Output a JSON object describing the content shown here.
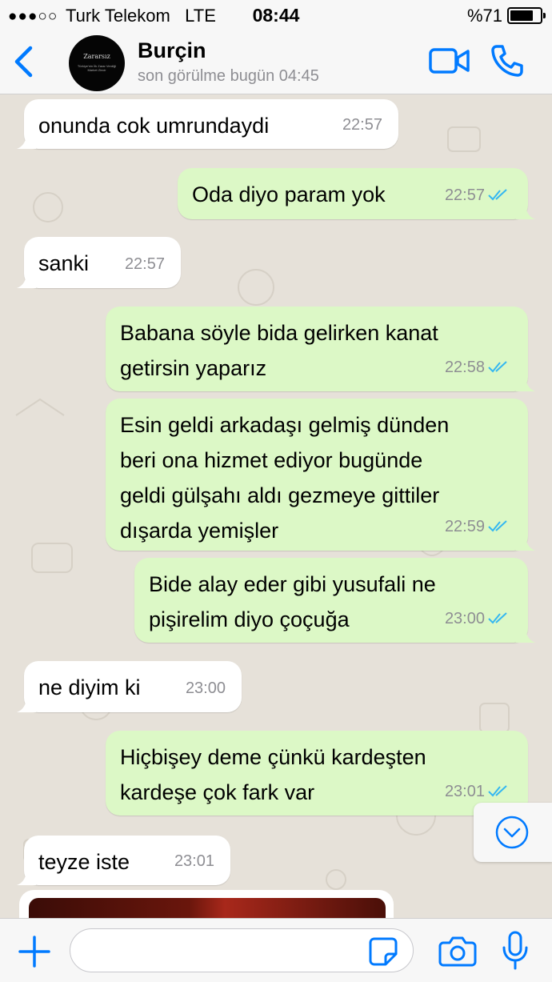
{
  "status_bar": {
    "signal": "●●●○○",
    "carrier": "Turk Telekom",
    "network": "LTE",
    "time": "08:44",
    "battery": "%71"
  },
  "header": {
    "avatar_text": "Zararsız",
    "avatar_subtext": "Türkiye'nin İlk Zarar Verdiği Market Zincir",
    "contact_name": "Burçin",
    "last_seen": "son görülme bugün 04:45"
  },
  "messages": [
    {
      "direction": "in",
      "text": "onunda cok umrundaydi",
      "time": "22:57"
    },
    {
      "direction": "out",
      "text": "Oda diyo param yok",
      "time": "22:57",
      "read": true
    },
    {
      "direction": "in",
      "text": "sanki",
      "time": "22:57"
    },
    {
      "direction": "out",
      "text": "Babana söyle bida gelirken kanat\ngetirsin yaparız",
      "time": "22:58",
      "read": true
    },
    {
      "direction": "out",
      "text": "Esin geldi arkadaşı gelmiş dünden\nberi ona hizmet ediyor bugünde\ngeldi gülşahı aldı gezmeye gittiler\ndışarda yemişler",
      "time": "22:59",
      "read": true
    },
    {
      "direction": "out",
      "text": "Bide alay eder gibi yusufali ne\npişirelim diyo çoçuğa",
      "time": "23:00",
      "read": true
    },
    {
      "direction": "in",
      "text": "ne diyim ki",
      "time": "23:00"
    },
    {
      "direction": "out",
      "text": "Hiçbişey deme çünkü kardeşten\nkardeşe çok fark var",
      "time": "23:01",
      "read": true
    },
    {
      "direction": "in",
      "text": "teyze iste",
      "time": "23:01"
    }
  ],
  "input": {
    "placeholder": "",
    "value": ""
  },
  "colors": {
    "accent": "#007aff",
    "incoming_bubble": "#ffffff",
    "outgoing_bubble": "#dcf8c6",
    "read_ticks": "#34b7f1",
    "chat_background": "#e6e1d9"
  },
  "icons": {
    "back": "chevron-left-icon",
    "video": "video-camera-icon",
    "call": "phone-icon",
    "attach": "plus-icon",
    "sticker": "sticker-icon",
    "camera": "camera-icon",
    "mic": "microphone-icon",
    "scroll": "chevron-down-circle-icon"
  }
}
